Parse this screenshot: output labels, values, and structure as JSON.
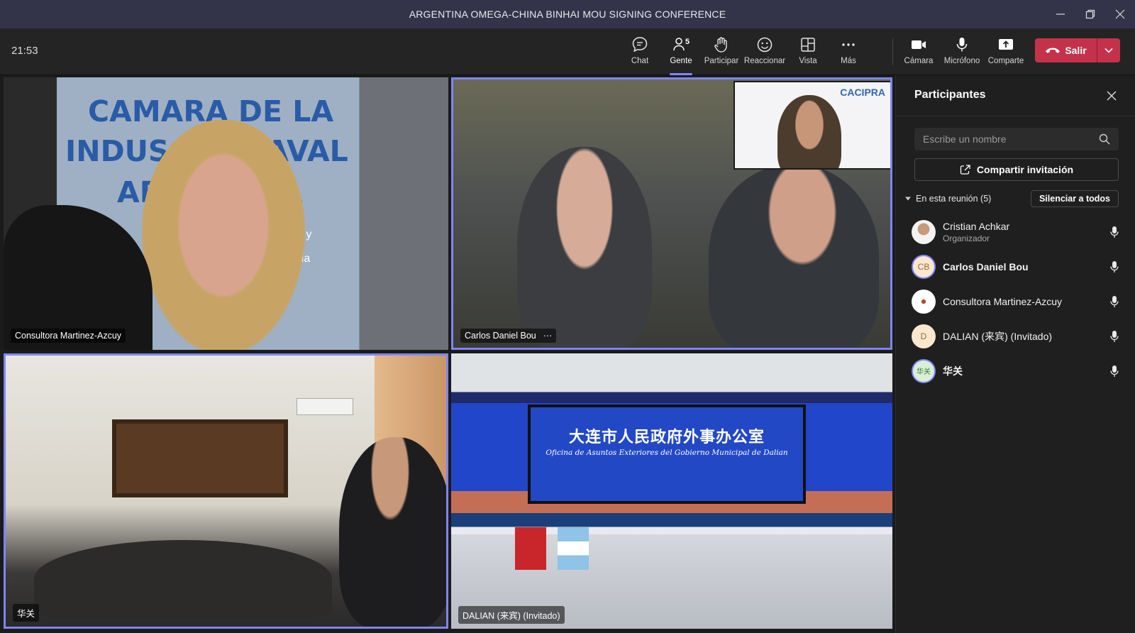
{
  "window": {
    "title": "ARGENTINA OMEGA-CHINA BINHAI MOU SIGNING CONFERENCE"
  },
  "toolbar": {
    "clock": "21:53",
    "chat": "Chat",
    "people": "Gente",
    "people_count": "5",
    "raise_hand": "Participar",
    "react": "Reaccionar",
    "view": "Vista",
    "more": "Más",
    "camera": "Cámara",
    "mic": "Micrófono",
    "share": "Comparte",
    "leave": "Salir"
  },
  "videos": {
    "tile1": {
      "name": "Consultora Martinez-Azcuy",
      "banner_lines": [
        "CAMARA DE LA",
        "INDUS",
        "AVAL",
        "AR",
        "A",
        "os y",
        "tria"
      ]
    },
    "tile2": {
      "name": "Carlos Daniel Bou",
      "more": "···",
      "pip_logo": "CACIPRA"
    },
    "tile3": {
      "name": "华关"
    },
    "tile4": {
      "name": "DALIAN (来宾) (Invitado)",
      "screen_zh": "大连市人民政府外事办公室",
      "screen_es": "Oficina de Asuntos Exteriores del Gobierno Municipal de Dalian"
    }
  },
  "participants_panel": {
    "title": "Participantes",
    "search_placeholder": "Escribe un nombre",
    "share_invite": "Compartir invitación",
    "section_label": "En esta reunión (5)",
    "mute_all": "Silenciar a todos",
    "people": [
      {
        "name": "Cristian Achkar",
        "role": "Organizador",
        "initials": ""
      },
      {
        "name": "Carlos Daniel Bou",
        "role": "",
        "initials": "CB"
      },
      {
        "name": "Consultora Martinez-Azcuy",
        "role": "",
        "initials": ""
      },
      {
        "name": "DALIAN (来宾) (Invitado)",
        "role": "",
        "initials": "D"
      },
      {
        "name": "华关",
        "role": "",
        "initials": "华关"
      }
    ]
  },
  "colors": {
    "titlebar": "#33344a",
    "accent": "#7f85f5",
    "leave": "#c4314b"
  }
}
